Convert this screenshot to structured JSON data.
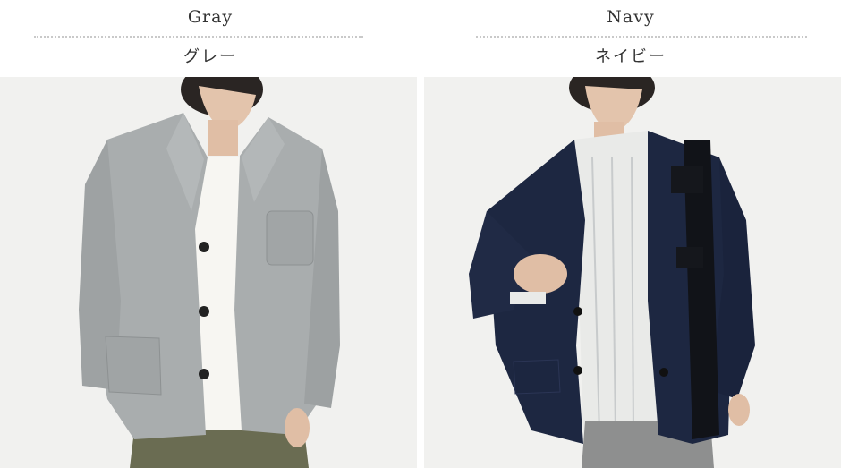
{
  "variants": [
    {
      "name_en": "Gray",
      "name_jp": "グレー",
      "jacket_color": "#a9adae"
    },
    {
      "name_en": "Navy",
      "name_jp": "ネイビー",
      "jacket_color": "#1d2741"
    }
  ]
}
